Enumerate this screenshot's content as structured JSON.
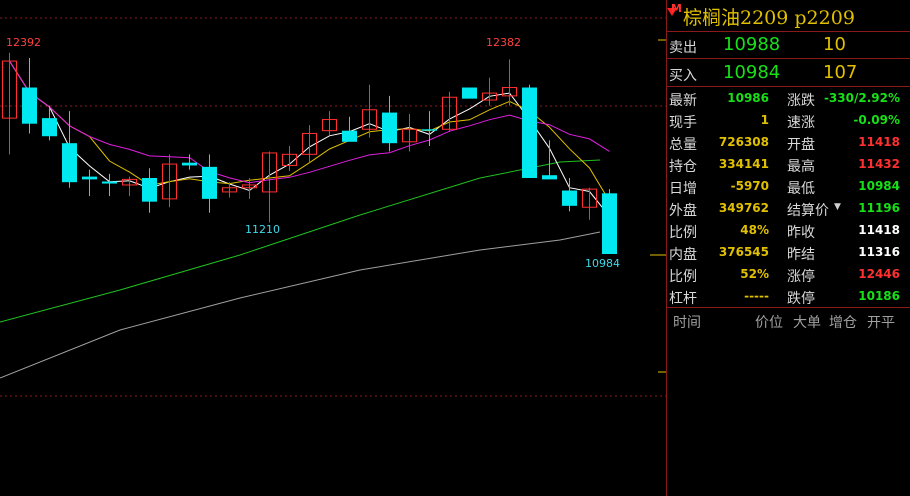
{
  "header": {
    "marker": "M",
    "title": "棕榈油2209  p2209"
  },
  "quote": {
    "sell_label": "卖出",
    "sell_price": "10988",
    "sell_vol": "10",
    "buy_label": "买入",
    "buy_price": "10984",
    "buy_vol": "107"
  },
  "stats": [
    {
      "label": "最新",
      "value": "10986",
      "color": "#18e018",
      "label2": "涨跌",
      "value2": "-330/2.92%",
      "color2": "#18e018"
    },
    {
      "label": "现手",
      "value": "1",
      "color": "#e0c000",
      "label2": "速涨",
      "value2": "-0.09%",
      "color2": "#18e018"
    },
    {
      "label": "总量",
      "value": "726308",
      "color": "#e0c000",
      "label2": "开盘",
      "value2": "11418",
      "color2": "#ff3030"
    },
    {
      "label": "持仓",
      "value": "334141",
      "color": "#e0c000",
      "label2": "最高",
      "value2": "11432",
      "color2": "#ff3030"
    },
    {
      "label": "日增",
      "value": "-5970",
      "color": "#e0c000",
      "label2": "最低",
      "value2": "10984",
      "color2": "#18e018"
    },
    {
      "label": "外盘",
      "value": "349762",
      "color": "#e0c000",
      "label2": "结算价",
      "value2": "11196",
      "color2": "#18e018"
    },
    {
      "label": "比例",
      "value": "48%",
      "color": "#e0c000",
      "label2": "昨收",
      "value2": "11418",
      "color2": "#ffffff"
    },
    {
      "label": "内盘",
      "value": "376545",
      "color": "#e0c000",
      "label2": "昨结",
      "value2": "11316",
      "color2": "#ffffff"
    },
    {
      "label": "比例",
      "value": "52%",
      "color": "#e0c000",
      "label2": "涨停",
      "value2": "12446",
      "color2": "#ff3030"
    },
    {
      "label": "杠杆",
      "value": "-----",
      "color": "#e0c000",
      "label2": "跌停",
      "value2": "10186",
      "color2": "#18e018"
    }
  ],
  "tick_table": {
    "headers": [
      "时间",
      "价位",
      "大单",
      "增仓",
      "开平"
    ]
  },
  "chart_data": {
    "type": "candlestick",
    "annotations": {
      "high1": "12392",
      "high2": "12382",
      "low1": "11210",
      "low2": "10984"
    },
    "candles": [
      {
        "o": 11960,
        "h": 12430,
        "l": 11700,
        "c": 12370
      },
      {
        "o": 12180,
        "h": 12392,
        "l": 11850,
        "c": 11920
      },
      {
        "o": 11960,
        "h": 12050,
        "l": 11800,
        "c": 11830
      },
      {
        "o": 11780,
        "h": 12010,
        "l": 11460,
        "c": 11500
      },
      {
        "o": 11540,
        "h": 11590,
        "l": 11400,
        "c": 11520
      },
      {
        "o": 11505,
        "h": 11560,
        "l": 11400,
        "c": 11490
      },
      {
        "o": 11480,
        "h": 11540,
        "l": 11400,
        "c": 11520
      },
      {
        "o": 11530,
        "h": 11600,
        "l": 11280,
        "c": 11360
      },
      {
        "o": 11380,
        "h": 11700,
        "l": 11320,
        "c": 11630
      },
      {
        "o": 11640,
        "h": 11700,
        "l": 11590,
        "c": 11620
      },
      {
        "o": 11610,
        "h": 11700,
        "l": 11280,
        "c": 11380
      },
      {
        "o": 11430,
        "h": 11500,
        "l": 11390,
        "c": 11460
      },
      {
        "o": 11460,
        "h": 11530,
        "l": 11380,
        "c": 11480
      },
      {
        "o": 11430,
        "h": 11720,
        "l": 11210,
        "c": 11710
      },
      {
        "o": 11620,
        "h": 11760,
        "l": 11580,
        "c": 11700
      },
      {
        "o": 11700,
        "h": 11910,
        "l": 11640,
        "c": 11850
      },
      {
        "o": 11870,
        "h": 12010,
        "l": 11840,
        "c": 11950
      },
      {
        "o": 11870,
        "h": 11970,
        "l": 11810,
        "c": 11790
      },
      {
        "o": 11880,
        "h": 12200,
        "l": 11820,
        "c": 12020
      },
      {
        "o": 12000,
        "h": 12120,
        "l": 11720,
        "c": 11780
      },
      {
        "o": 11790,
        "h": 11990,
        "l": 11720,
        "c": 11880
      },
      {
        "o": 11880,
        "h": 12010,
        "l": 11760,
        "c": 11870
      },
      {
        "o": 11880,
        "h": 12150,
        "l": 11860,
        "c": 12110
      },
      {
        "o": 12180,
        "h": 12150,
        "l": 12110,
        "c": 12100
      },
      {
        "o": 12090,
        "h": 12250,
        "l": 12050,
        "c": 12140
      },
      {
        "o": 12120,
        "h": 12382,
        "l": 12050,
        "c": 12180
      },
      {
        "o": 12180,
        "h": 12200,
        "l": 11530,
        "c": 11530
      },
      {
        "o": 11550,
        "h": 11800,
        "l": 11520,
        "c": 11520
      },
      {
        "o": 11440,
        "h": 11530,
        "l": 11290,
        "c": 11330
      },
      {
        "o": 11320,
        "h": 11460,
        "l": 11230,
        "c": 11450
      },
      {
        "o": 11420,
        "h": 11450,
        "l": 10984,
        "c": 10984
      }
    ]
  }
}
